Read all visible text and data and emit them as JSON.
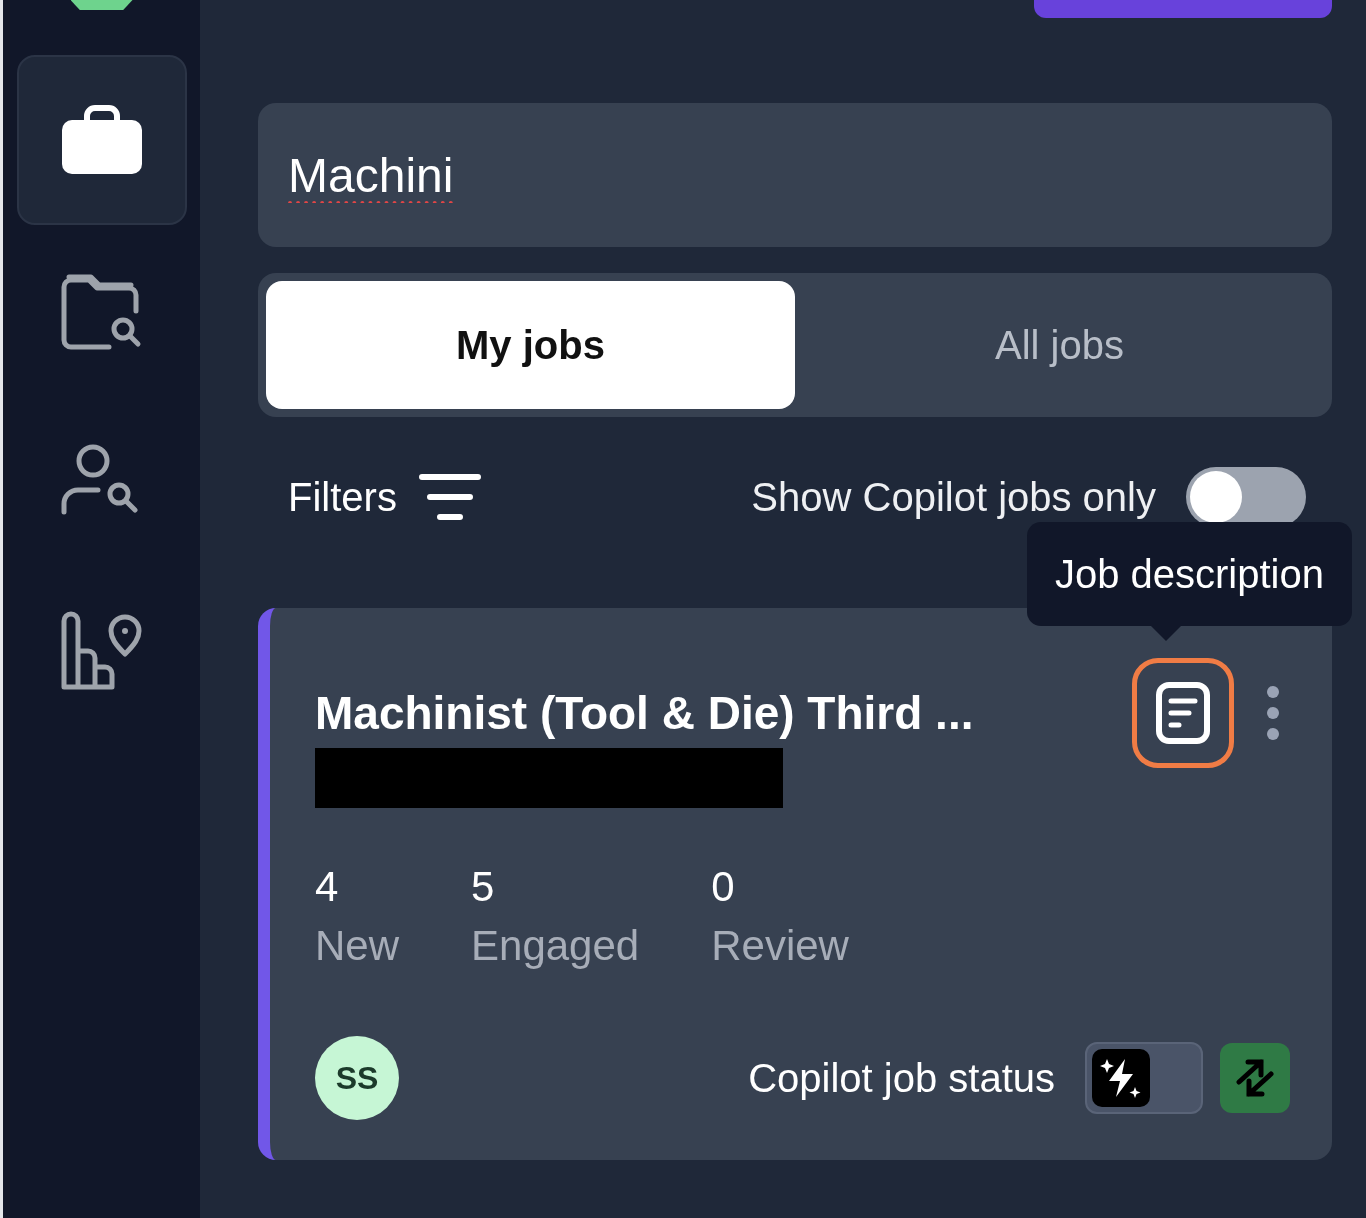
{
  "sidebar": {
    "items": [
      {
        "kind": "briefcase",
        "selected": true
      },
      {
        "kind": "folder-search",
        "selected": false
      },
      {
        "kind": "person-search",
        "selected": false
      },
      {
        "kind": "chart-pin",
        "selected": false
      }
    ]
  },
  "search": {
    "value": "Machini",
    "misspelled": true
  },
  "tabs": [
    {
      "label": "My jobs",
      "selected": true
    },
    {
      "label": "All jobs",
      "selected": false
    }
  ],
  "filters": {
    "label": "Filters"
  },
  "copilot_only": {
    "label": "Show Copilot jobs only",
    "on": false
  },
  "tooltip": {
    "text": "Job description"
  },
  "job_card": {
    "title": "Machinist (Tool & Die) Third ...",
    "redacted": true,
    "stats": [
      {
        "count": "4",
        "label": "New"
      },
      {
        "count": "5",
        "label": "Engaged"
      },
      {
        "count": "0",
        "label": "Review"
      }
    ],
    "avatar": "SS",
    "status_label": "Copilot job status",
    "copilot_status": {
      "on": false
    }
  }
}
